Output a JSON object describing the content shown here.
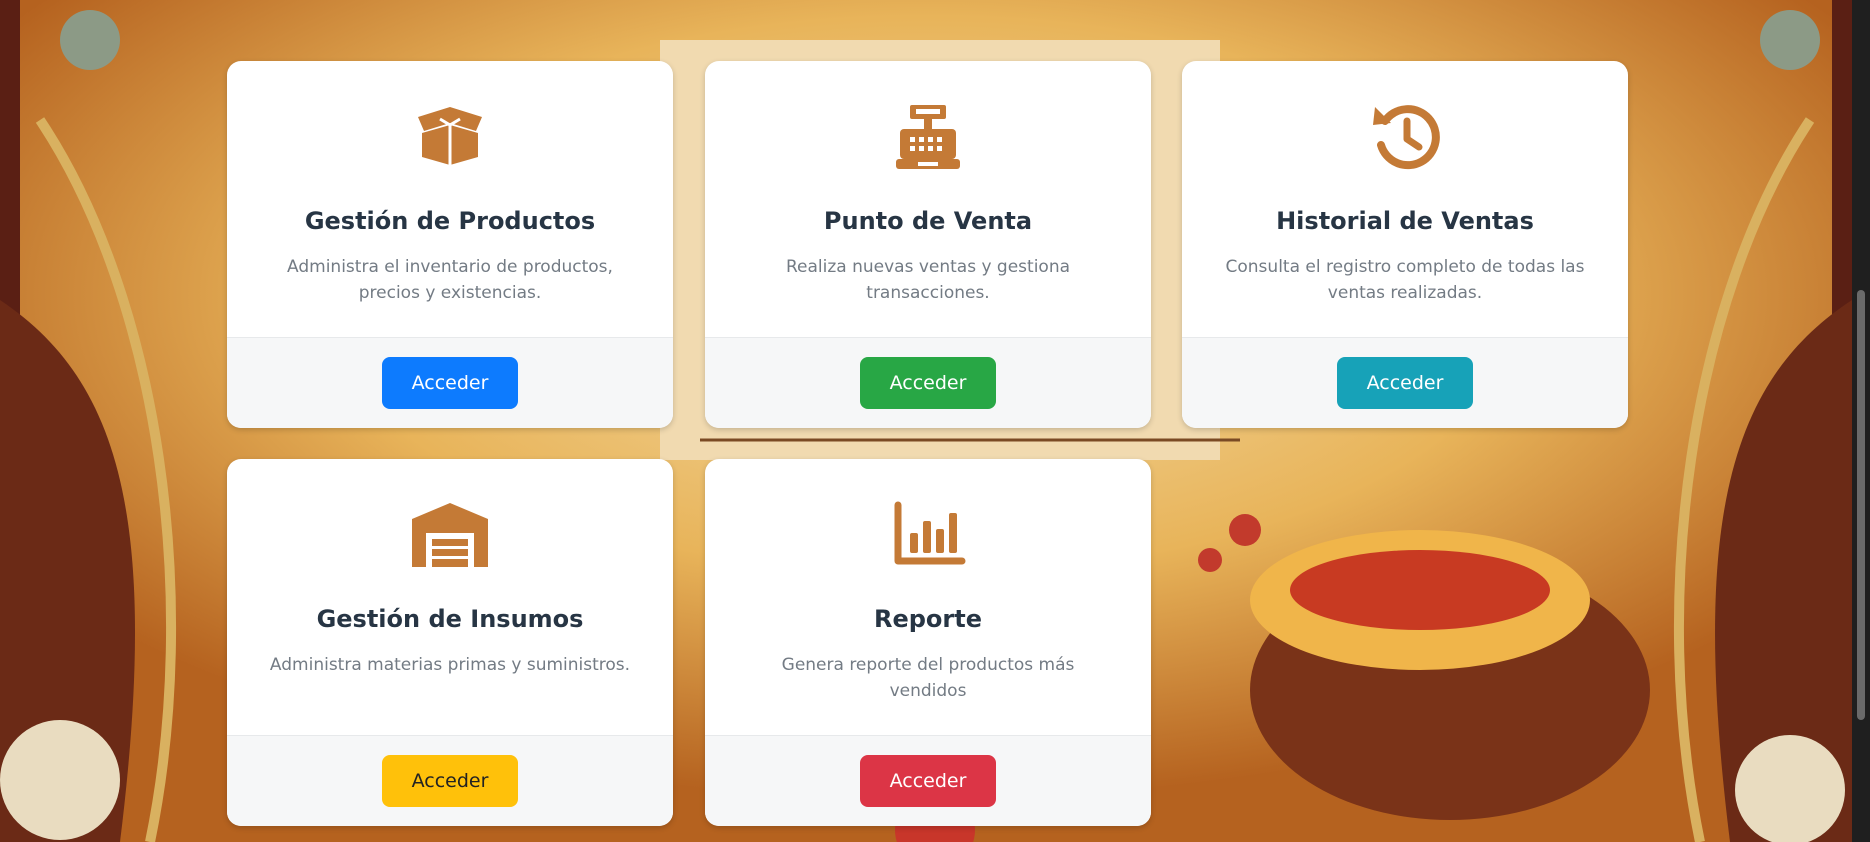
{
  "colors": {
    "icon": "#c47a36",
    "title": "#273544",
    "description": "#737b84",
    "primary": "#0d7bfe",
    "success": "#28a745",
    "info": "#17a2b8",
    "warning": "#ffc10a",
    "danger": "#dc3546"
  },
  "cards": [
    {
      "icon": "box-open-icon",
      "title": "Gestión de Productos",
      "description": "Administra el inventario de productos, precios y existencias.",
      "button": "Acceder",
      "button_color": "blue"
    },
    {
      "icon": "cash-register-icon",
      "title": "Punto de Venta",
      "description": "Realiza nuevas ventas y gestiona transacciones.",
      "button": "Acceder",
      "button_color": "green"
    },
    {
      "icon": "history-icon",
      "title": "Historial de Ventas",
      "description": "Consulta el registro completo de todas las ventas realizadas.",
      "button": "Acceder",
      "button_color": "teal"
    },
    {
      "icon": "warehouse-icon",
      "title": "Gestión de Insumos",
      "description": "Administra materias primas y suministros.",
      "button": "Acceder",
      "button_color": "yellow"
    },
    {
      "icon": "bar-chart-icon",
      "title": "Reporte",
      "description": "Genera reporte del productos más vendidos",
      "button": "Acceder",
      "button_color": "red"
    }
  ]
}
